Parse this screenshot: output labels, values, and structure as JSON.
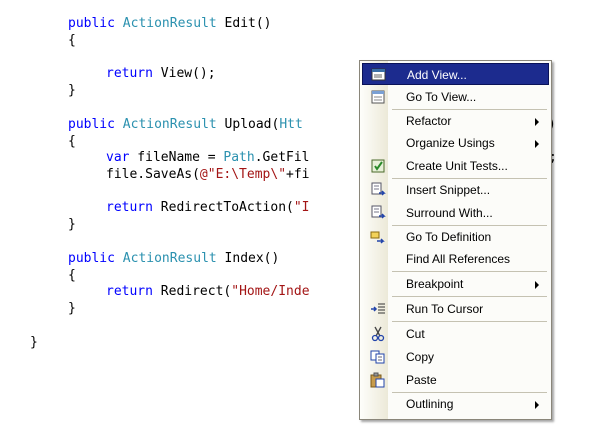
{
  "code": {
    "edit_kw": "public",
    "edit_type": "ActionResult",
    "edit_sig": " Edit()",
    "brace_open": "{",
    "brace_close": "}",
    "return_kw": "return",
    "edit_body": " View();",
    "upload_kw": "public",
    "upload_type": "ActionResult",
    "upload_sig": " Upload(",
    "upload_partial": "Htt",
    "upload_tail": ")",
    "var_kw": "var",
    "var_rest": " fileName = ",
    "path_type": "Path",
    "var_call": ".GetFil",
    "var_end": ";",
    "save_call": "file.SaveAs(",
    "save_str": "@\"E:\\Temp\\\"",
    "save_rest": "+fi",
    "redirect_action": " RedirectToAction(",
    "redirect_action_str": "\"I",
    "index_kw": "public",
    "index_type": "ActionResult",
    "index_sig": " Index()",
    "redirect_call": " Redirect(",
    "redirect_str": "\"Home/Inde",
    "class_close": "}"
  },
  "context_menu": {
    "add_view": "Add View...",
    "go_to_view": "Go To View...",
    "refactor": "Refactor",
    "organize_usings": "Organize Usings",
    "create_unit_tests": "Create Unit Tests...",
    "insert_snippet": "Insert Snippet...",
    "surround_with": "Surround With...",
    "go_to_definition": "Go To Definition",
    "find_all_references": "Find All References",
    "breakpoint": "Breakpoint",
    "run_to_cursor": "Run To Cursor",
    "cut": "Cut",
    "copy": "Copy",
    "paste": "Paste",
    "outlining": "Outlining"
  },
  "colors": {
    "keyword": "#0000ff",
    "type": "#2b91af",
    "string": "#a31515",
    "highlight": "#1c2b8e"
  }
}
